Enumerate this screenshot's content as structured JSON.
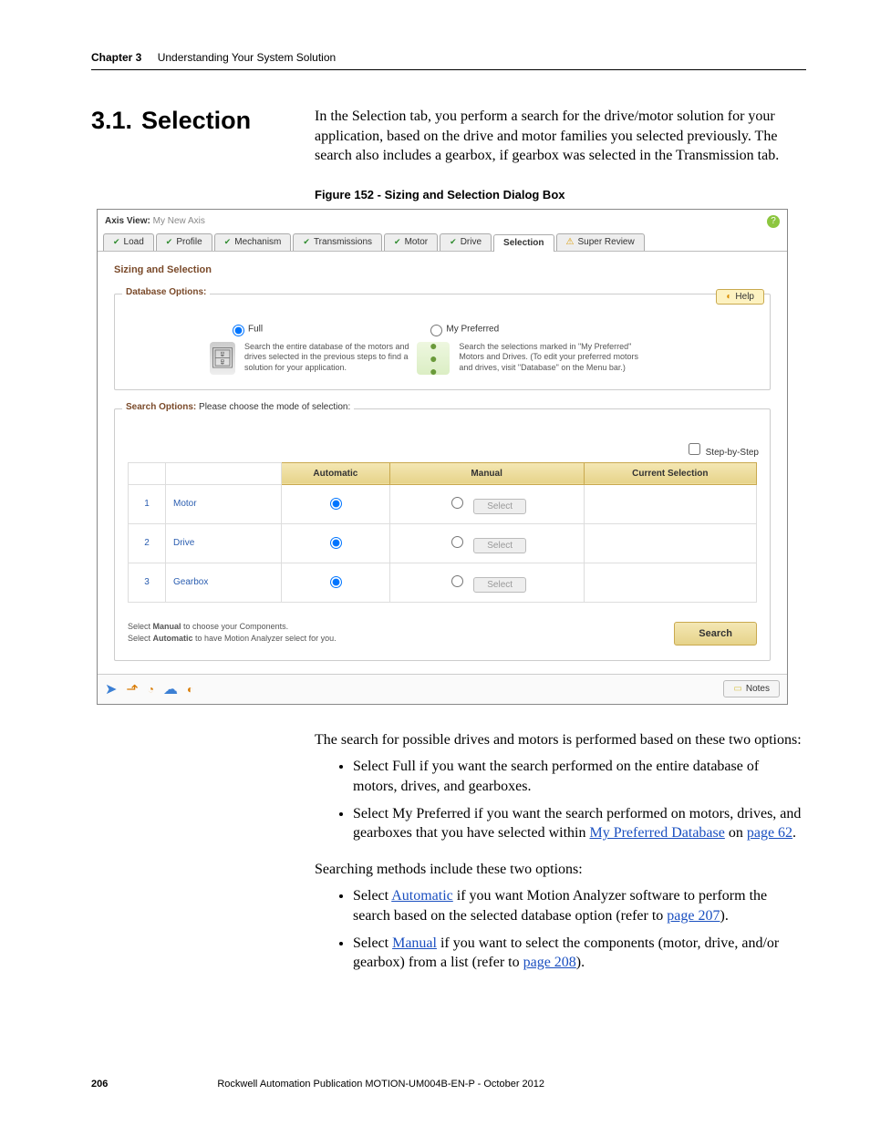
{
  "header": {
    "chapter": "Chapter 3",
    "title": "Understanding Your System Solution"
  },
  "section": {
    "number": "3.1.",
    "title": "Selection"
  },
  "intro": "In the Selection tab, you perform a search for the drive/motor solution for your application, based on the drive and motor families you selected previously. The search also includes a gearbox, if gearbox was selected in the Transmission tab.",
  "figure_caption": "Figure 152 - Sizing and Selection Dialog Box",
  "shot": {
    "title_prefix": "Axis View:",
    "title_value": "My New Axis",
    "tabs": [
      "Load",
      "Profile",
      "Mechanism",
      "Transmissions",
      "Motor",
      "Drive",
      "Selection",
      "Super Review"
    ],
    "panel_title": "Sizing and Selection",
    "help_label": "Help",
    "db_legend": "Database Options:",
    "full_label": "Full",
    "full_desc": "Search the entire database of the motors and drives selected in the previous steps to find a solution for your application.",
    "pref_label": "My Preferred",
    "pref_desc": "Search the selections marked in \"My Preferred\" Motors and Drives. (To edit your preferred motors and drives, visit \"Database\" on the Menu bar.)",
    "search_legend_a": "Search Options:",
    "search_legend_b": "Please choose the mode of selection:",
    "step_label": "Step-by-Step",
    "cols": {
      "auto": "Automatic",
      "manual": "Manual",
      "current": "Current Selection"
    },
    "rows": [
      {
        "n": "1",
        "name": "Motor"
      },
      {
        "n": "2",
        "name": "Drive"
      },
      {
        "n": "3",
        "name": "Gearbox"
      }
    ],
    "select_btn": "Select",
    "hint1_a": "Select ",
    "hint1_b": "Manual",
    "hint1_c": " to choose your Components.",
    "hint2_a": "Select ",
    "hint2_b": "Automatic",
    "hint2_c": " to have Motion Analyzer select for you.",
    "search_btn": "Search",
    "notes_btn": "Notes"
  },
  "after": {
    "p1": "The search for possible drives and motors is performed based on these two options:",
    "b1": "Select Full if you want the search performed on the entire database of motors, drives, and gearboxes.",
    "b2_a": "Select My Preferred if you want the search performed on motors, drives, and gearboxes that you have selected within ",
    "b2_link": "My Preferred Database",
    "b2_b": " on ",
    "b2_link2": "page 62",
    "b2_c": ".",
    "p2": "Searching methods include these two options:",
    "b3_a": "Select ",
    "b3_link": "Automatic",
    "b3_b": " if you want Motion Analyzer software to perform the search based on the selected database option (refer to ",
    "b3_link2": "page 207",
    "b3_c": ").",
    "b4_a": "Select ",
    "b4_link": "Manual",
    "b4_b": " if you want to select the components (motor, drive, and/or gearbox) from a list (refer to ",
    "b4_link2": "page 208",
    "b4_c": ")."
  },
  "footer": {
    "page": "206",
    "pub": "Rockwell Automation Publication MOTION-UM004B-EN-P - October 2012"
  }
}
